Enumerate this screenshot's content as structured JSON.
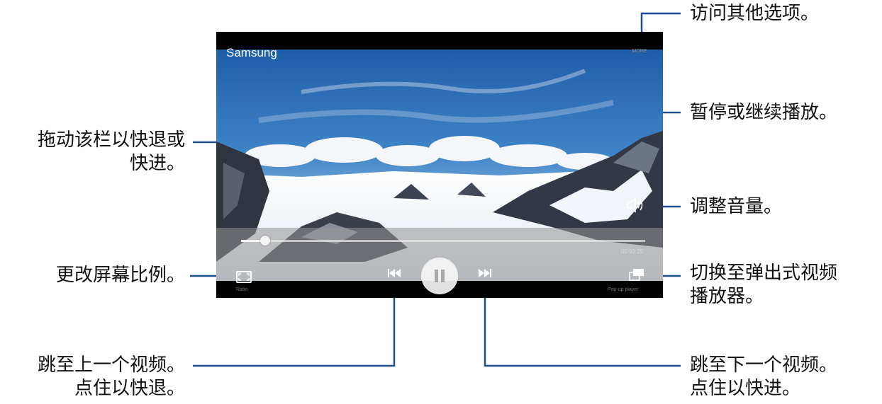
{
  "player": {
    "video_title": "Samsung",
    "more_label": "MORE",
    "remaining_time": "00:03:25",
    "ratio_label": "Ratio",
    "popup_label": "Pop-up player",
    "progress": 0.06
  },
  "annotations": {
    "more_options": "访问其他选项。",
    "pause_resume": "暂停或继续播放。",
    "seek_bar": [
      "拖动该栏以快退或",
      "快进。"
    ],
    "volume": "调整音量。",
    "ratio": "更改屏幕比例。",
    "popup": [
      "切换至弹出式视频",
      "播放器。"
    ],
    "previous": [
      "跳至上一个视频。",
      "点住以快退。"
    ],
    "next": [
      "跳至下一个视频。",
      "点住以快进。"
    ]
  },
  "colors": {
    "callout_line": "#1f4e8c",
    "sky": "#2c6fb8",
    "snow": "#f2f5f8"
  },
  "icons": {
    "ratio": "aspect-ratio-icon",
    "previous": "skip-previous-icon",
    "pause": "pause-icon",
    "next": "skip-next-icon",
    "volume": "speaker-icon",
    "popup": "popup-player-icon"
  }
}
